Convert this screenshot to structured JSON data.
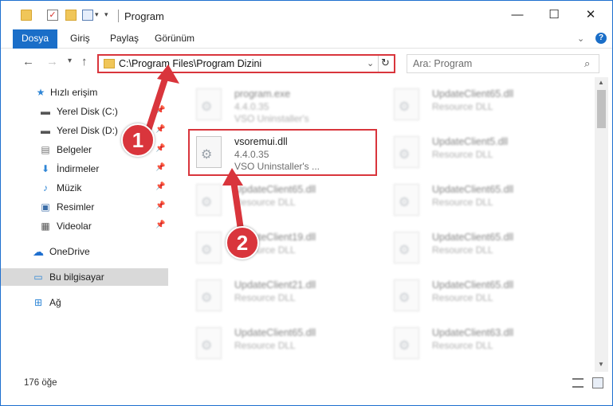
{
  "window": {
    "title": "Program",
    "controls": {
      "minimize": "—",
      "maximize": "☐",
      "close": "✕"
    }
  },
  "quick_access_toolbar": {
    "check_glyph": "✓",
    "caret": "▾",
    "caret2": "▾"
  },
  "ribbon": {
    "file_tab": "Dosya",
    "tabs": [
      "Giriş",
      "Paylaş",
      "Görünüm"
    ],
    "collapse_glyph": "⌄",
    "help_glyph": "?"
  },
  "navigation": {
    "back": "←",
    "forward": "→",
    "recent": "▾",
    "up": "↑",
    "address": "C:\\Program Files\\Program Dizini",
    "address_dropdown": "⌄",
    "refresh": "↻",
    "search_placeholder": "Ara: Program",
    "search_glyph": "⌕"
  },
  "sidebar": {
    "quick_access": {
      "label": "Hızlı erişim",
      "icon": "star-icon"
    },
    "pinned": [
      {
        "label": "Yerel Disk (C:)",
        "icon": "drive-icon"
      },
      {
        "label": "Yerel Disk (D:)",
        "icon": "drive-icon"
      },
      {
        "label": "Belgeler",
        "icon": "documents-icon"
      },
      {
        "label": "İndirmeler",
        "icon": "download-icon"
      },
      {
        "label": "Müzik",
        "icon": "music-icon"
      },
      {
        "label": "Resimler",
        "icon": "pictures-icon"
      },
      {
        "label": "Videolar",
        "icon": "videos-icon"
      }
    ],
    "pin_glyph": "📌",
    "onedrive": "OneDrive",
    "this_pc": "Bu bilgisayar",
    "network": "Ağ"
  },
  "files": {
    "left": [
      {
        "name": "program.exe",
        "line2": "4.4.0.35",
        "line3": "VSO Uninstaller's",
        "blurred": true
      },
      {
        "name": "vsoremui.dll",
        "line2": "4.4.0.35",
        "line3": "VSO Uninstaller's   ...",
        "blurred": false
      },
      {
        "name": "UpdateClient65.dll",
        "line2": "Resource DLL",
        "line3": "",
        "blurred": true
      },
      {
        "name": "UpdateClient19.dll",
        "line2": "Resource DLL",
        "line3": "",
        "blurred": true
      },
      {
        "name": "UpdateClient21.dll",
        "line2": "Resource DLL",
        "line3": "",
        "blurred": true
      },
      {
        "name": "UpdateClient65.dll",
        "line2": "Resource DLL",
        "line3": "",
        "blurred": true
      }
    ],
    "right": [
      {
        "name": "UpdateClient65.dll",
        "line2": "Resource DLL"
      },
      {
        "name": "UpdateClient5.dll",
        "line2": "Resource DLL"
      },
      {
        "name": "UpdateClient65.dll",
        "line2": "Resource DLL"
      },
      {
        "name": "UpdateClient65.dll",
        "line2": "Resource DLL"
      },
      {
        "name": "UpdateClient65.dll",
        "line2": "Resource DLL"
      },
      {
        "name": "UpdateClient63.dll",
        "line2": "Resource DLL"
      }
    ],
    "gear_glyph": "⚙"
  },
  "scrollbar": {
    "up": "▲",
    "down": "▼"
  },
  "status": {
    "item_count": "176 öğe"
  },
  "annotations": [
    {
      "number": "1",
      "color": "#d9353c"
    },
    {
      "number": "2",
      "color": "#d9353c"
    }
  ]
}
